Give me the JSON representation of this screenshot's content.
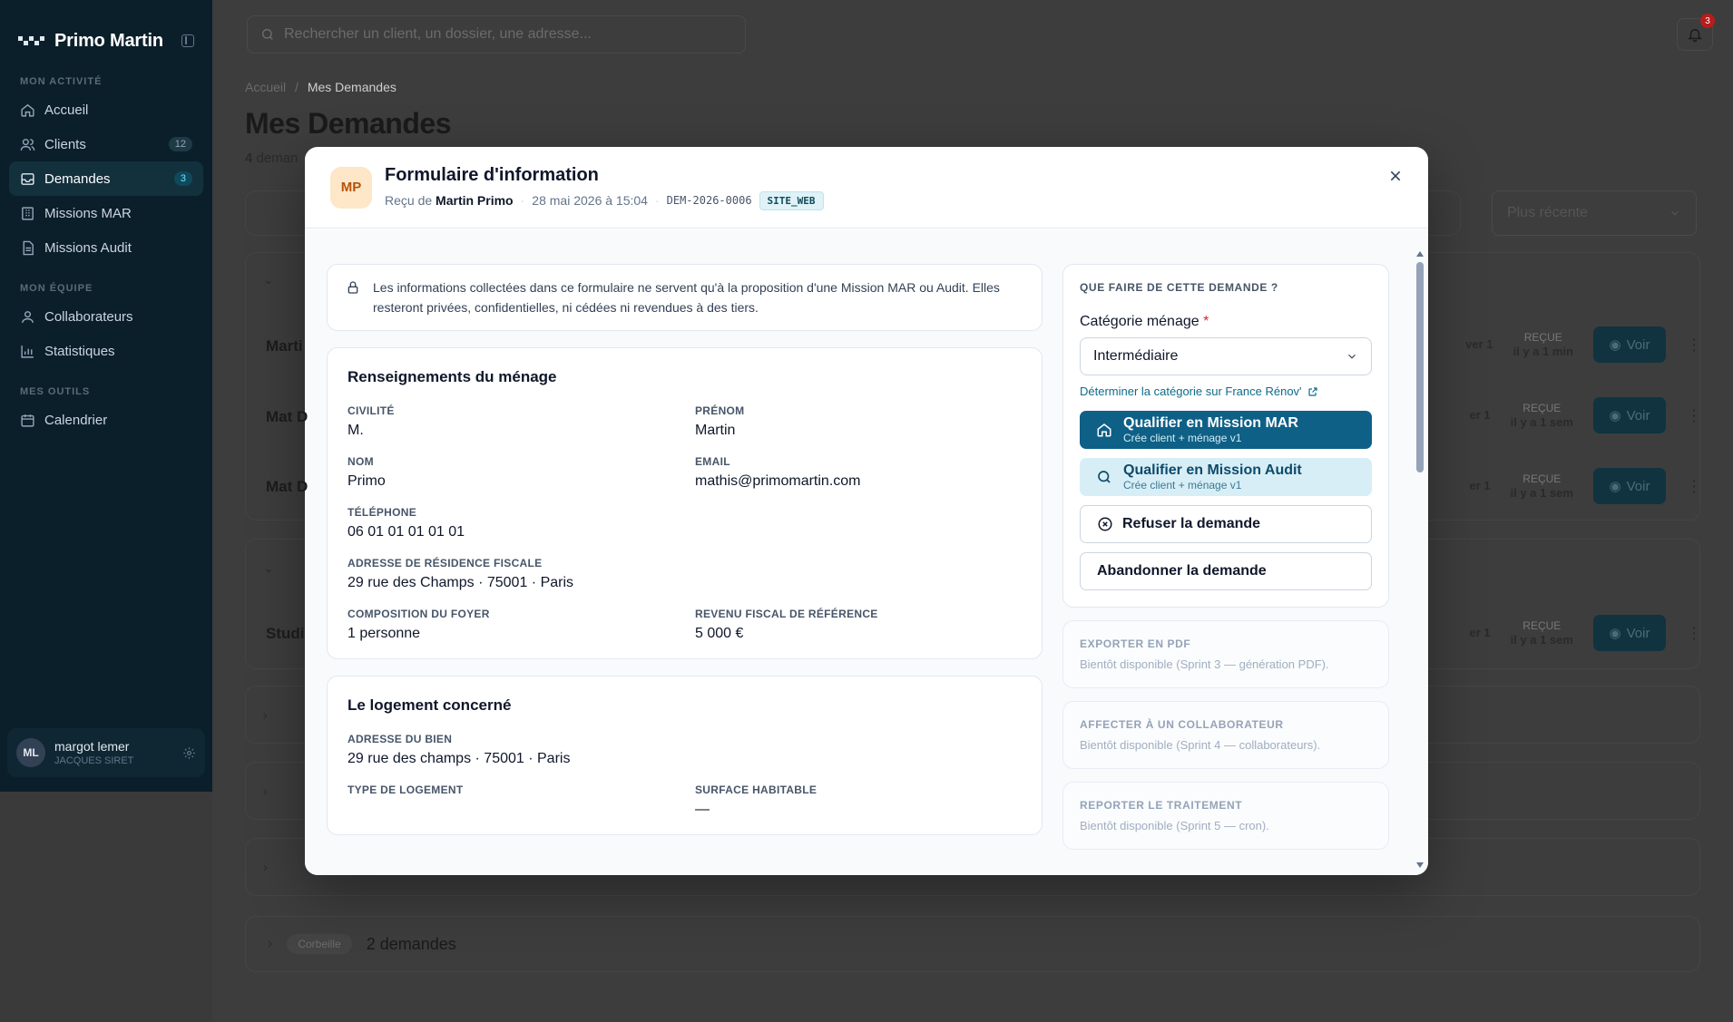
{
  "sidebar": {
    "brand": "Primo Martin",
    "sections": [
      {
        "label": "MON ACTIVITÉ"
      },
      {
        "label": "MON ÉQUIPE"
      },
      {
        "label": "MES OUTILS"
      }
    ],
    "items": [
      {
        "label": "Accueil",
        "icon": "home-icon"
      },
      {
        "label": "Clients",
        "icon": "users-icon",
        "badge": "12"
      },
      {
        "label": "Demandes",
        "icon": "inbox-icon",
        "badge": "3"
      },
      {
        "label": "Missions MAR",
        "icon": "building-icon"
      },
      {
        "label": "Missions Audit",
        "icon": "document-icon"
      },
      {
        "label": "Collaborateurs",
        "icon": "user-icon"
      },
      {
        "label": "Statistiques",
        "icon": "chart-icon"
      },
      {
        "label": "Calendrier",
        "icon": "calendar-icon"
      }
    ],
    "user": {
      "initials": "ML",
      "name": "margot lemer",
      "org": "JACQUES SIRET"
    }
  },
  "topbar": {
    "search_placeholder": "Rechercher un client, un dossier, une adresse...",
    "notif_count": "3"
  },
  "page": {
    "breadcrumb_root": "Accueil",
    "breadcrumb_sep": "/",
    "breadcrumb_current": "Mes Demandes",
    "title": "Mes Demandes",
    "subtitle_count": "4",
    "subtitle_text": "deman",
    "sort_label": "Plus récente",
    "rows": [
      {
        "name": "Marti",
        "status": "REÇUE",
        "when": "il y a 1 min",
        "side": "ver 1",
        "action": "Voir"
      },
      {
        "name": "Mat D",
        "status": "REÇUE",
        "when": "il y a 1 sem",
        "side": "er 1",
        "action": "Voir"
      },
      {
        "name": "Mat D",
        "status": "REÇUE",
        "when": "il y a 1 sem",
        "side": "er 1",
        "action": "Voir"
      },
      {
        "name": "Studi",
        "status": "REÇUE",
        "when": "il y a 1 sem",
        "side": "er 1",
        "action": "Voir"
      }
    ],
    "trash_tag": "Corbeille",
    "trash_count": "2 demandes"
  },
  "modal": {
    "avatar": "MP",
    "title": "Formulaire d'information",
    "received_prefix": "Reçu de",
    "sender": "Martin Primo",
    "date": "28 mai 2026 à 15:04",
    "ref": "DEM-2026-0006",
    "source": "SITE_WEB",
    "notice": "Les informations collectées dans ce formulaire ne servent qu'à la proposition d'une Mission MAR ou Audit. Elles resteront privées, confidentielles, ni cédées ni revendues à des tiers.",
    "household": {
      "title": "Renseignements du ménage",
      "civilite_label": "CIVILITÉ",
      "civilite": "M.",
      "prenom_label": "PRÉNOM",
      "prenom": "Martin",
      "nom_label": "NOM",
      "nom": "Primo",
      "email_label": "EMAIL",
      "email": "mathis@primomartin.com",
      "tel_label": "TÉLÉPHONE",
      "tel": "06 01 01 01 01 01",
      "adresse_label": "ADRESSE DE RÉSIDENCE FISCALE",
      "adresse": "29 rue des Champs · 75001 · Paris",
      "foyer_label": "COMPOSITION DU FOYER",
      "foyer": "1 personne",
      "revenu_label": "REVENU FISCAL DE RÉFÉRENCE",
      "revenu": "5 000 €"
    },
    "housing": {
      "title": "Le logement concerné",
      "adresse_label": "ADRESSE DU BIEN",
      "adresse": "29 rue des champs · 75001 · Paris",
      "type_label": "TYPE DE LOGEMENT",
      "type": "",
      "surface_label": "SURFACE HABITABLE",
      "surface": "—"
    },
    "actions": {
      "heading": "QUE FAIRE DE CETTE DEMANDE ?",
      "category_label": "Catégorie ménage",
      "required_mark": "*",
      "category_value": "Intermédiaire",
      "category_link": "Déterminer la catégorie sur France Rénov'",
      "qualify_mar": "Qualifier en Mission MAR",
      "qualify_mar_sub": "Crée client + ménage v1",
      "qualify_audit": "Qualifier en Mission Audit",
      "qualify_audit_sub": "Crée client + ménage v1",
      "refuse": "Refuser la demande",
      "abandon": "Abandonner la demande"
    },
    "upcoming": [
      {
        "label": "EXPORTER EN PDF",
        "text": "Bientôt disponible (Sprint 3 — génération PDF)."
      },
      {
        "label": "AFFECTER À UN COLLABORATEUR",
        "text": "Bientôt disponible (Sprint 4 — collaborateurs)."
      },
      {
        "label": "REPORTER LE TRAITEMENT",
        "text": "Bientôt disponible (Sprint 5 — cron)."
      }
    ]
  }
}
